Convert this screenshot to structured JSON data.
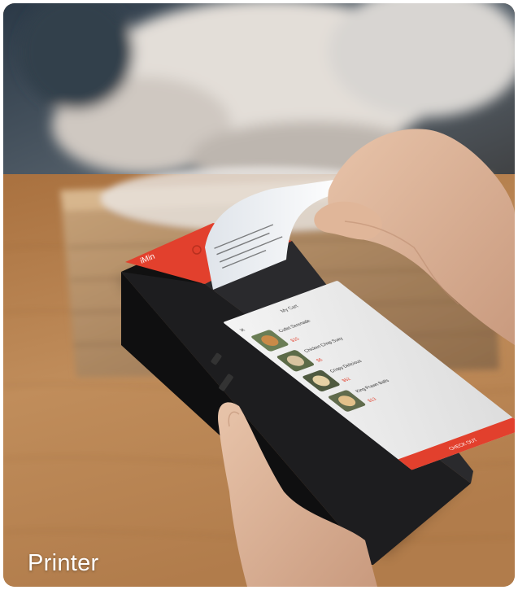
{
  "caption": {
    "label": "Printer"
  },
  "device": {
    "brand": "iMin",
    "screen": {
      "title": "My Cart",
      "close_glyph": "×",
      "items": [
        {
          "name": "Cutlet Serenade",
          "price": "$15"
        },
        {
          "name": "Chicken Chop Suey",
          "price": "$6"
        },
        {
          "name": "Crispy Delicious",
          "price": "$52"
        },
        {
          "name": "King Prawn Balls",
          "price": "$13"
        }
      ],
      "checkout_label": "CHECK OUT"
    }
  },
  "colors": {
    "accent": "#e2402d",
    "wood": "#b88a58",
    "device_body": "#1d1d1f"
  }
}
